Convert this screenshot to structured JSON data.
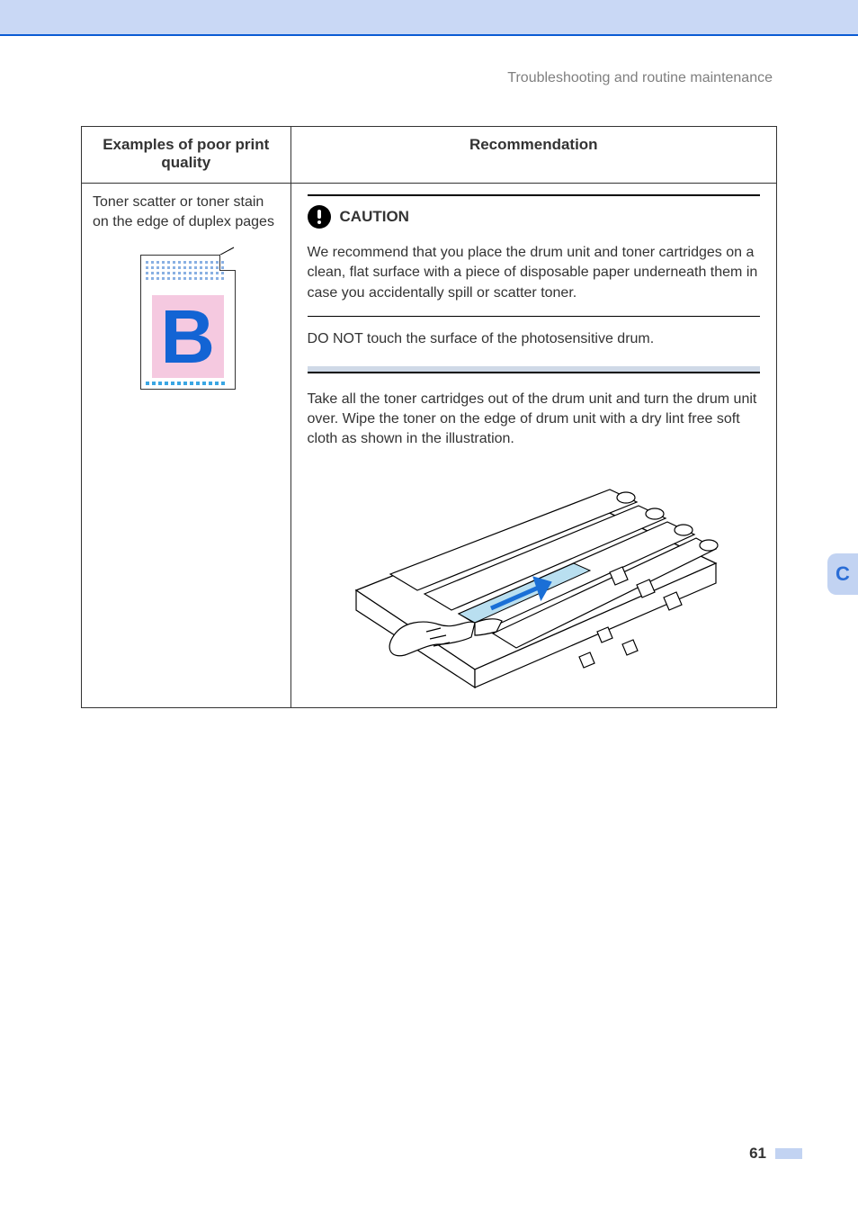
{
  "header": {
    "section_title": "Troubleshooting and routine maintenance"
  },
  "table": {
    "head": {
      "left": "Examples of poor print quality",
      "right": "Recommendation"
    },
    "row": {
      "example_title": "Toner scatter or toner stain on the edge of duplex pages",
      "sample_letter": "B",
      "caution": {
        "label": "CAUTION",
        "p1": "We recommend that you place the drum unit and toner cartridges on a clean, flat surface with a piece of disposable paper underneath them in case you accidentally spill or scatter toner.",
        "p2": "DO NOT touch the surface of the photosensitive drum."
      },
      "instruction": "Take all the toner cartridges out of the drum unit and turn the drum unit over. Wipe the toner on the edge of drum unit with a dry lint free soft cloth as shown in the illustration."
    }
  },
  "side_tab": {
    "label": "C"
  },
  "footer": {
    "page_number": "61"
  }
}
